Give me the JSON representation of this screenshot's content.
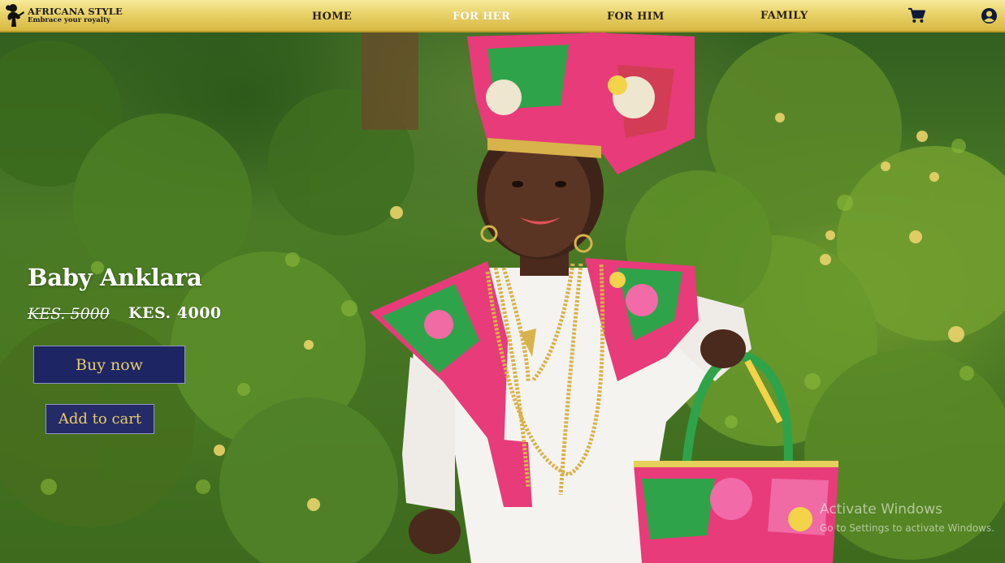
{
  "brand": {
    "name": "AFRICANA STYLE",
    "tagline": "Embrace your royalty",
    "logo_icon": "woman-silhouette-icon"
  },
  "nav": {
    "links": [
      {
        "label": "HOME",
        "active": false
      },
      {
        "label": "FOR HER",
        "active": true
      },
      {
        "label": "FOR HIM",
        "active": false
      },
      {
        "label": "FAMILY",
        "active": false
      }
    ],
    "cart_icon": "shopping-cart-icon",
    "account_icon": "user-account-icon"
  },
  "hero": {
    "image_subject": "hero-photo-child-in-floral-ankara",
    "product": {
      "title": "Baby Anklara",
      "old_price": "KES. 5000",
      "new_price": "KES. 4000"
    },
    "buttons": {
      "buy_now": "Buy now",
      "add_to_cart": "Add to cart"
    }
  },
  "watermark": {
    "title": "Activate Windows",
    "subtitle": "Go to Settings to activate Windows."
  },
  "colors": {
    "navbar_gold": "#e9d269",
    "button_navy": "#1e2563",
    "button_text_gold": "#e7cd6b",
    "active_nav": "#ffffff"
  }
}
